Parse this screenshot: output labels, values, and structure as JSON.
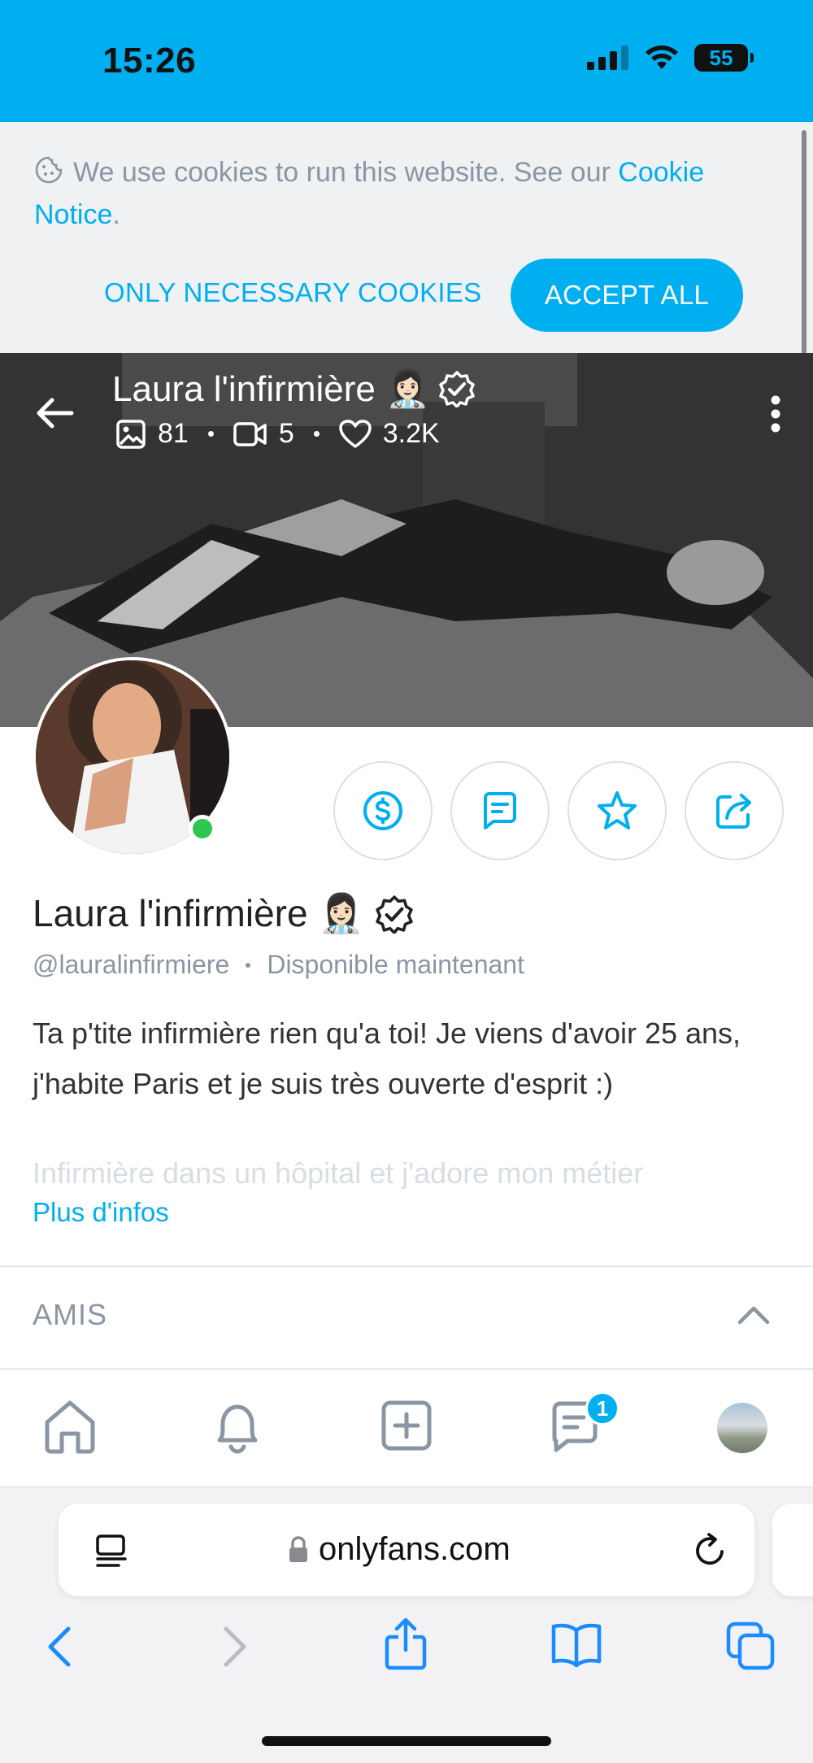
{
  "status_bar": {
    "time": "15:26",
    "battery": "55"
  },
  "cookie_banner": {
    "text": "We use cookies to run this website. See our ",
    "link": "Cookie Notice",
    "suffix": ".",
    "necessary_label": "ONLY NECESSARY COOKIES",
    "accept_label": "ACCEPT ALL"
  },
  "cover": {
    "name": "Laura l'infirmière 👩🏻‍⚕️",
    "photos": "81",
    "videos": "5",
    "likes": "3.2K"
  },
  "profile": {
    "name": "Laura l'infirmière 👩🏻‍⚕️",
    "handle": "@lauralinfirmiere",
    "availability": "Disponible maintenant",
    "bio": "Ta p'tite infirmière rien qu'a toi! Je viens d'avoir 25 ans, j'habite Paris et je suis très ouverte d'esprit :)",
    "bio_faded": "Infirmière dans un hôpital et j'adore mon métier",
    "more_info": "Plus d'infos"
  },
  "friends": {
    "title": "AMIS"
  },
  "bottom_nav": {
    "messages_badge": "1"
  },
  "browser": {
    "url": "onlyfans.com"
  },
  "colors": {
    "accent": "#00aff0",
    "online": "#2fc650",
    "muted": "#8a96a3"
  }
}
